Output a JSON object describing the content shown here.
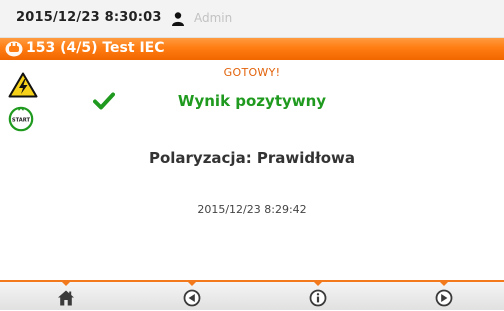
{
  "status_bar": {
    "datetime": "2015/12/23 8:30:03",
    "user": "Admin",
    "user_icon": "user-icon"
  },
  "title_bar": {
    "icon": "plug-icon",
    "title": "153 (4/5) Test IEC"
  },
  "main": {
    "ready_label": "GOTOWY!",
    "result": "Wynik pozytywny",
    "polarization": "Polaryzacja: Prawidłowa",
    "measurement_time": "2015/12/23 8:29:42",
    "start_label": "START",
    "icons": [
      "warning-icon",
      "start-icon",
      "check-icon"
    ]
  },
  "toolbar": {
    "buttons": [
      {
        "icon": "home-icon"
      },
      {
        "icon": "back-icon"
      },
      {
        "icon": "info-icon"
      },
      {
        "icon": "next-icon"
      }
    ]
  },
  "colors": {
    "accent": "#ff7d12",
    "ready": "#e2620a",
    "result_ok": "#1f9a1f",
    "text_dark": "#333333",
    "user_disabled": "#c2c2c2"
  }
}
